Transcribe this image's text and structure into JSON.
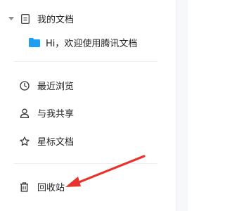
{
  "sidebar": {
    "my_docs": {
      "label": "我的文档",
      "icons": [
        "caret-down-icon",
        "document-icon"
      ]
    },
    "my_docs_children": [
      {
        "label": "Hi，欢迎使用腾讯文档",
        "icon": "folder-icon"
      }
    ],
    "nav": [
      {
        "label": "最近浏览",
        "icon": "clock-icon"
      },
      {
        "label": "与我共享",
        "icon": "user-icon"
      },
      {
        "label": "星标文档",
        "icon": "star-icon"
      }
    ],
    "trash": {
      "label": "回收站",
      "icon": "trash-icon"
    }
  },
  "annotation": {
    "type": "arrow",
    "color": "#e8332c",
    "points_to": "trash"
  },
  "colors": {
    "folder": "#1e9ff2",
    "icon": "#333333",
    "caret": "#8a8f99",
    "arrow": "#e8332c"
  }
}
